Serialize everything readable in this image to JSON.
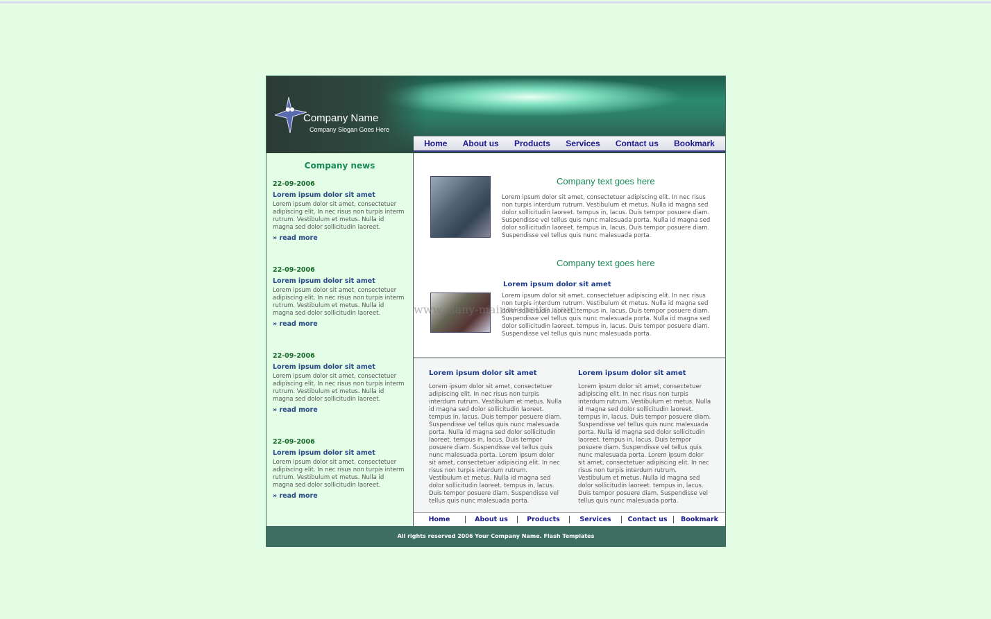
{
  "header": {
    "company_name": "Company Name",
    "slogan": "Company Slogan Goes Here"
  },
  "nav": [
    "Home",
    "About us",
    "Products",
    "Services",
    "Contact us",
    "Bookmark"
  ],
  "news": {
    "title": "Company news",
    "items": [
      {
        "date": "22-09-2006",
        "title": "Lorem ipsum dolor sit amet",
        "text": "Lorem ipsum dolor sit amet, consectetuer adipiscing elit. In nec risus non turpis interm rutrum. Vestibulum et metus. Nulla id magna sed dolor sollicitudin laoreet.",
        "more": "read more"
      },
      {
        "date": "22-09-2006",
        "title": "Lorem ipsum dolor sit amet",
        "text": "Lorem ipsum dolor sit amet, consectetuer adipiscing elit. In nec risus non turpis interm rutrum. Vestibulum et metus. Nulla id magna sed dolor sollicitudin laoreet.",
        "more": "read more"
      },
      {
        "date": "22-09-2006",
        "title": "Lorem ipsum dolor sit amet",
        "text": "Lorem ipsum dolor sit amet, consectetuer adipiscing elit. In nec risus non turpis interm rutrum. Vestibulum et metus. Nulla id magna sed dolor sollicitudin laoreet.",
        "more": "read more"
      },
      {
        "date": "22-09-2006",
        "title": "Lorem ipsum dolor sit amet",
        "text": "Lorem ipsum dolor sit amet, consectetuer adipiscing elit. In nec risus non turpis interm rutrum. Vestibulum et metus. Nulla id magna sed dolor sollicitudin laoreet.",
        "more": "read more"
      }
    ]
  },
  "main": {
    "section1": {
      "title": "Company text goes here",
      "text": "Lorem ipsum dolor sit amet, consectetuer adipiscing elit. In nec risus non turpis interdum rutrum. Vestibulum et metus. Nulla id magna sed dolor sollicitudin laoreet. tempus in, lacus. Duis tempor posuere diam. Suspendisse vel tellus quis nunc malesuada porta. Nulla id magna sed dolor sollicitudin laoreet. tempus in, lacus. Duis tempor posuere diam. Suspendisse vel tellus quis nunc malesuada porta."
    },
    "section2": {
      "title": "Company text goes here",
      "subtitle": "Lorem ipsum dolor sit amet",
      "text": "Lorem ipsum dolor sit amet, consectetuer adipiscing elit. In nec risus non turpis interdum rutrum. Vestibulum et metus. Nulla id magna sed dolor sollicitudin laoreet. tempus in, lacus. Duis tempor posuere diam. Suspendisse vel tellus quis nunc malesuada porta. Nulla id magna sed dolor sollicitudin laoreet. tempus in, lacus. Duis tempor posuere diam. Suspendisse vel tellus quis nunc malesuada porta."
    },
    "watermark": "www.many-mainwebsite.com"
  },
  "columns": [
    {
      "title": "Lorem ipsum dolor sit amet",
      "text": "Lorem ipsum dolor sit amet, consectetuer adipiscing elit. In nec risus non turpis interdum rutrum. Vestibulum et metus. Nulla id magna sed dolor sollicitudin laoreet. tempus in, lacus. Duis tempor posuere diam. Suspendisse vel tellus quis nunc malesuada porta. Nulla id magna sed dolor sollicitudin laoreet. tempus in, lacus. Duis tempor posuere diam. Suspendisse vel tellus quis nunc malesuada porta. Lorem ipsum dolor sit amet, consectetuer adipiscing elit. In nec risus non turpis interdum rutrum. Vestibulum et metus. Nulla id magna sed dolor sollicitudin laoreet. tempus in, lacus. Duis tempor posuere diam. Suspendisse vel tellus quis nunc malesuada porta."
    },
    {
      "title": "Lorem ipsum dolor sit amet",
      "text": "Lorem ipsum dolor sit amet, consectetuer adipiscing elit. In nec risus non turpis interdum rutrum. Vestibulum et metus. Nulla id magna sed dolor sollicitudin laoreet. tempus in, lacus. Duis tempor posuere diam. Suspendisse vel tellus quis nunc malesuada porta. Nulla id magna sed dolor sollicitudin laoreet. tempus in, lacus. Duis tempor posuere diam. Suspendisse vel tellus quis nunc malesuada porta. Lorem ipsum dolor sit amet, consectetuer adipiscing elit. In nec risus non turpis interdum rutrum. Vestibulum et metus. Nulla id magna sed dolor sollicitudin laoreet. tempus in, lacus. Duis tempor posuere diam. Suspendisse vel tellus quis nunc malesuada porta."
    }
  ],
  "footer": {
    "nav": [
      "Home",
      "About us",
      "Products",
      "Services",
      "Contact us",
      "Bookmark"
    ],
    "copyright": "All rights reserved 2006 Your Company Name. Flash Templates"
  }
}
